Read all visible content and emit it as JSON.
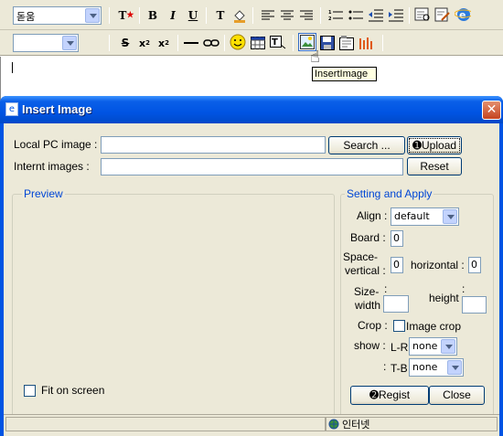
{
  "toolbar": {
    "font_select": "돋움",
    "size_select": "",
    "buttons": {
      "text_style_icon": "T",
      "bold": "B",
      "italic": "I",
      "underline": "U",
      "font_color_icon": "T",
      "strike": "S",
      "subscript": "x",
      "superscript": "x"
    },
    "tooltip": "InsertImage"
  },
  "dialog": {
    "title": "Insert Image",
    "close_glyph": "✕",
    "local_pc_label": "Local PC image :",
    "internet_label": "Internt images   :",
    "search_button": "Search ...",
    "upload_button": "➊Upload",
    "reset_button": "Reset",
    "preview_legend": "Preview",
    "fit_on_screen": "Fit on screen",
    "setting_legend": "Setting and Apply",
    "align_label": "Align :",
    "align_value": "default",
    "board_label": "Board :",
    "board_value": "0",
    "space_label_1": "Space-",
    "space_label_2": "vertical :",
    "vertical_value": "0",
    "horizontal_label": "horizontal :",
    "horizontal_value": "0",
    "size_label_1": "Size-",
    "size_label_2": "width",
    "size_colon": ":",
    "height_label": "height",
    "height_colon": ":",
    "crop_label": "Crop :",
    "image_crop": "Image crop",
    "show_label": "show :",
    "lr_label": "L-R",
    "lr_value": "none",
    "tb_colon": ":",
    "tb_label": "T-B",
    "tb_value": "none",
    "regist_button": "➋Regist",
    "close_button": "Close",
    "status_zone": "인터넷"
  }
}
